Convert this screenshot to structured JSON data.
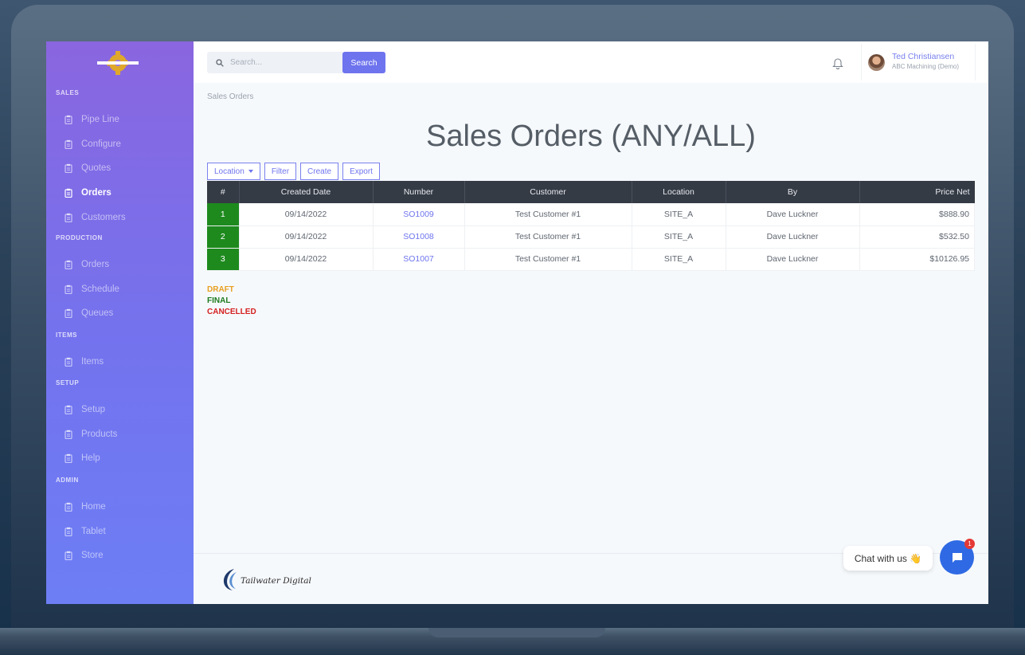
{
  "sidebar": {
    "sections": [
      {
        "label": "SALES",
        "items": [
          {
            "label": "Pipe Line",
            "active": false
          },
          {
            "label": "Configure",
            "active": false
          },
          {
            "label": "Quotes",
            "active": false
          },
          {
            "label": "Orders",
            "active": true
          },
          {
            "label": "Customers",
            "active": false
          }
        ]
      },
      {
        "label": "PRODUCTION",
        "items": [
          {
            "label": "Orders",
            "active": false
          },
          {
            "label": "Schedule",
            "active": false
          },
          {
            "label": "Queues",
            "active": false
          }
        ]
      },
      {
        "label": "ITEMS",
        "items": [
          {
            "label": "Items",
            "active": false
          }
        ]
      },
      {
        "label": "SETUP",
        "items": [
          {
            "label": "Setup",
            "active": false
          },
          {
            "label": "Products",
            "active": false
          },
          {
            "label": "Help",
            "active": false
          }
        ]
      },
      {
        "label": "ADMIN",
        "items": [
          {
            "label": "Home",
            "active": false
          },
          {
            "label": "Tablet",
            "active": false
          },
          {
            "label": "Store",
            "active": false
          }
        ]
      }
    ]
  },
  "topbar": {
    "search_placeholder": "Search...",
    "search_button": "Search",
    "user_name": "Ted Christiansen",
    "user_company": "ABC Machining (Demo)"
  },
  "breadcrumb": "Sales Orders",
  "page_title": "Sales Orders (ANY/ALL)",
  "toolbar": {
    "location": "Location",
    "filter": "Filter",
    "create": "Create",
    "export": "Export"
  },
  "table": {
    "columns": [
      "#",
      "Created Date",
      "Number",
      "Customer",
      "Location",
      "By",
      "Price Net"
    ],
    "rows": [
      [
        "1",
        "09/14/2022",
        "SO1009",
        "Test Customer #1",
        "SITE_A",
        "Dave Luckner",
        "$888.90"
      ],
      [
        "2",
        "09/14/2022",
        "SO1008",
        "Test Customer #1",
        "SITE_A",
        "Dave Luckner",
        "$532.50"
      ],
      [
        "3",
        "09/14/2022",
        "SO1007",
        "Test Customer #1",
        "SITE_A",
        "Dave Luckner",
        "$10126.95"
      ]
    ]
  },
  "legend": [
    {
      "label": "DRAFT",
      "color": "#e8a020"
    },
    {
      "label": "FINAL",
      "color": "#1e7a1e"
    },
    {
      "label": "CANCELLED",
      "color": "#d42020"
    }
  ],
  "footer": {
    "brand": "Tailwater Digital"
  },
  "chat": {
    "label": "Chat with us 👋",
    "badge": "1"
  },
  "colors": {
    "accent": "#6e74ee",
    "final_row": "#1e8a1e",
    "header_dark": "#353b45"
  }
}
